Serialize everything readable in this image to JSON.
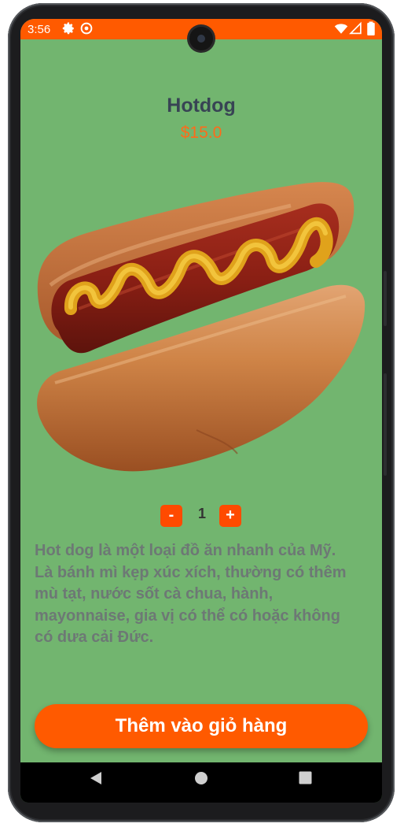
{
  "status_bar": {
    "time": "3:56",
    "icons_left": [
      "settings-icon",
      "vpn-icon"
    ],
    "icons_right": [
      "wifi-icon",
      "signal-icon",
      "battery-icon"
    ],
    "color": "#ff5a00"
  },
  "product": {
    "name": "Hotdog",
    "price": "$15.0",
    "image": "hotdog-image"
  },
  "quantity": {
    "minus_label": "-",
    "value": "1",
    "plus_label": "+"
  },
  "description": "Hot dog là một loại đồ ăn nhanh của Mỹ. Là bánh mì kẹp xúc xích, thường có thêm mù tạt, nước sốt cà chua, hành, mayonnaise, gia vị có thể có hoặc không có dưa cải Đức.",
  "add_to_cart_label": "Thêm vào giỏ hàng",
  "nav_bar": [
    "back-icon",
    "home-icon",
    "recents-icon"
  ],
  "colors": {
    "background": "#72b56f",
    "accent": "#ff5a00",
    "title": "#384454",
    "price": "#ff6a1a",
    "description": "#6d7875"
  }
}
